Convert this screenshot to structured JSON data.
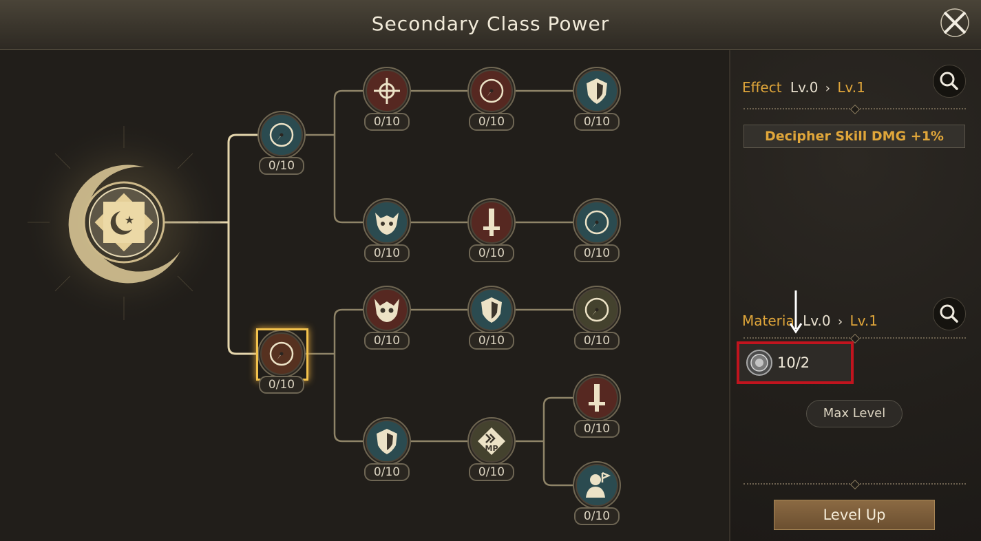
{
  "header": {
    "title": "Secondary Class Power",
    "close_icon": "close-x-icon"
  },
  "tree": {
    "root": {
      "icon": "star-crescent-emblem-icon"
    },
    "nodes": [
      {
        "id": "n1",
        "icon": "compass-icon",
        "count": "0/10",
        "tint": "#2b6a78"
      },
      {
        "id": "n2",
        "icon": "compass-icon",
        "count": "0/10",
        "tint": "#7a3b20",
        "selected": true
      },
      {
        "id": "n3",
        "icon": "crosshair-icon",
        "count": "0/10",
        "tint": "#7a2a22"
      },
      {
        "id": "n4",
        "icon": "compass-icon",
        "count": "0/10",
        "tint": "#7a2a22"
      },
      {
        "id": "n5",
        "icon": "shield-icon",
        "count": "0/10",
        "tint": "#2b6a78"
      },
      {
        "id": "n6",
        "icon": "beast-skull-icon",
        "count": "0/10",
        "tint": "#2b6a78"
      },
      {
        "id": "n7",
        "icon": "sword-icon",
        "count": "0/10",
        "tint": "#7a2a22"
      },
      {
        "id": "n8",
        "icon": "compass-icon",
        "count": "0/10",
        "tint": "#2b6a78"
      },
      {
        "id": "n9",
        "icon": "horned-skull-icon",
        "count": "0/10",
        "tint": "#7a2a22"
      },
      {
        "id": "n10",
        "icon": "shield-icon",
        "count": "0/10",
        "tint": "#2b6a78"
      },
      {
        "id": "n11",
        "icon": "compass-icon",
        "count": "0/10",
        "tint": "#5a5a3a"
      },
      {
        "id": "n12",
        "icon": "sword-icon",
        "count": "0/10",
        "tint": "#7a2a22"
      },
      {
        "id": "n13",
        "icon": "shield-icon",
        "count": "0/10",
        "tint": "#2b6a78"
      },
      {
        "id": "n14",
        "icon": "mp-boost-icon",
        "count": "0/10",
        "tint": "#5a5a3a"
      },
      {
        "id": "n15",
        "icon": "bust-flag-icon",
        "count": "0/10",
        "tint": "#2b6a78"
      }
    ]
  },
  "effect": {
    "label": "Effect",
    "level_from": "Lv.0",
    "level_to": "Lv.1",
    "description": "Decipher Skill DMG +1%"
  },
  "material": {
    "label": "Materia",
    "level_from": "Lv.0",
    "level_to": "Lv.1",
    "item_icon": "material-orb-icon",
    "quantity": "10/2"
  },
  "buttons": {
    "max_level": "Max Level",
    "level_up": "Level Up"
  },
  "colors": {
    "accent_gold": "#e0a63a",
    "highlight_red": "#c1141e"
  }
}
